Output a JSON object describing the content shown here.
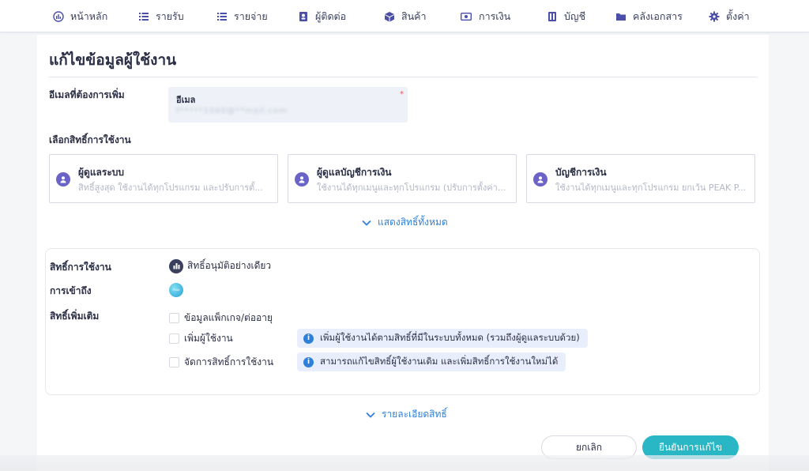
{
  "nav": {
    "items": [
      {
        "label": "หน้าหลัก",
        "icon": "dashboard-icon"
      },
      {
        "label": "รายรับ",
        "icon": "income-list-icon"
      },
      {
        "label": "รายจ่าย",
        "icon": "expense-list-icon"
      },
      {
        "label": "ผู้ติดต่อ",
        "icon": "contact-book-icon"
      },
      {
        "label": "สินค้า",
        "icon": "box-icon"
      },
      {
        "label": "การเงิน",
        "icon": "money-icon"
      },
      {
        "label": "บัญชี",
        "icon": "ledger-icon"
      },
      {
        "label": "คลังเอกสาร",
        "icon": "folder-icon"
      },
      {
        "label": "ตั้งค่า",
        "icon": "gear-icon"
      }
    ]
  },
  "page": {
    "title": "แก้ไขข้อมูลผู้ใช้งาน"
  },
  "email": {
    "section_label": "อีเมลที่ต้องการเพิ่ม",
    "field_label": "อีเมล",
    "required_mark": "*",
    "value": "f*****1000@**mail.com"
  },
  "roles": {
    "section_label": "เลือกสิทธิ์การใช้งาน",
    "cards": [
      {
        "name": "ผู้ดูแลระบบ",
        "desc": "สิทธิ์สูงสุด ใช้งานได้ทุกโปรแกรม และปรับการตั้..."
      },
      {
        "name": "ผู้ดูแลบัญชีการเงิน",
        "desc": "ใช้งานได้ทุกเมนูและทุกโปรแกรม (ปรับการตั้งค่า..."
      },
      {
        "name": "บัญชีการเงิน",
        "desc": "ใช้งานได้ทุกเมนูและทุกโปรแกรม ยกเว้น PEAK P..."
      }
    ],
    "show_all": "แสดงสิทธิ์ทั้งหมด"
  },
  "permissions": {
    "usage_label": "สิทธิ์การใช้งาน",
    "usage_value": "สิทธิ์อนุมัติอย่างเดียว",
    "access_label": "การเข้าถึง",
    "access_logo_text": "PEAK",
    "extra_label": "สิทธิ์เพิ่มเติม",
    "extras": [
      {
        "label": "ข้อมูลแพ็กเกจ/ต่ออายุ",
        "checked": false,
        "info": ""
      },
      {
        "label": "เพิ่มผู้ใช้งาน",
        "checked": false,
        "info": "เพิ่มผู้ใช้งานได้ตามสิทธิ์ที่มีในระบบทั้งหมด (รวมถึงผู้ดูแลระบบด้วย)"
      },
      {
        "label": "จัดการสิทธิ์การใช้งาน",
        "checked": false,
        "info": "สามารถแก้ไขสิทธิ์ผู้ใช้งานเดิม และเพิ่มสิทธิ์การใช้งานใหม่ได้"
      }
    ],
    "details_link": "รายละเอียดสิทธิ์"
  },
  "actions": {
    "cancel": "ยกเลิก",
    "confirm": "ยืนยันการแก้ไข"
  },
  "colors": {
    "accent": "#29b6c5",
    "link": "#2f80d8",
    "role_avatar": "#6c63c9",
    "info_bg": "#e8eefb"
  }
}
